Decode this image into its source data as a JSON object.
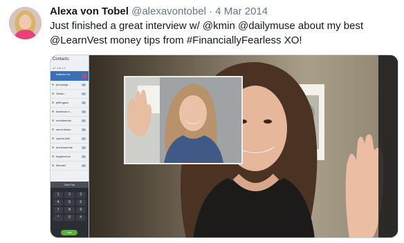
{
  "tweet": {
    "author_name": "Alexa von Tobel",
    "handle": "@alexavontobel",
    "separator": "·",
    "date": "4 Mar 2014",
    "text": "Just finished a great interview w/ @kmin @dailymuse about my best @LearnVest money tips from #FinanciallyFearless XO!"
  },
  "video_call": {
    "sidebar_title": "Contacts",
    "section_label": "AT CALLS",
    "active_contact": "Kathleen M.",
    "contacts": [
      "jennyangl...",
      "Sandu",
      "jeffengacs",
      "facebook.e...",
      "emkatmedia",
      "stevenkesto",
      "sophie.blisl",
      "leonleamente",
      "largetcomm",
      "Michael"
    ],
    "dial_label": "Dial Pad",
    "keypad": [
      "1",
      "2",
      "3",
      "4",
      "5",
      "6",
      "7",
      "8",
      "9",
      "*",
      "0",
      "#"
    ],
    "call_label": "Call"
  }
}
